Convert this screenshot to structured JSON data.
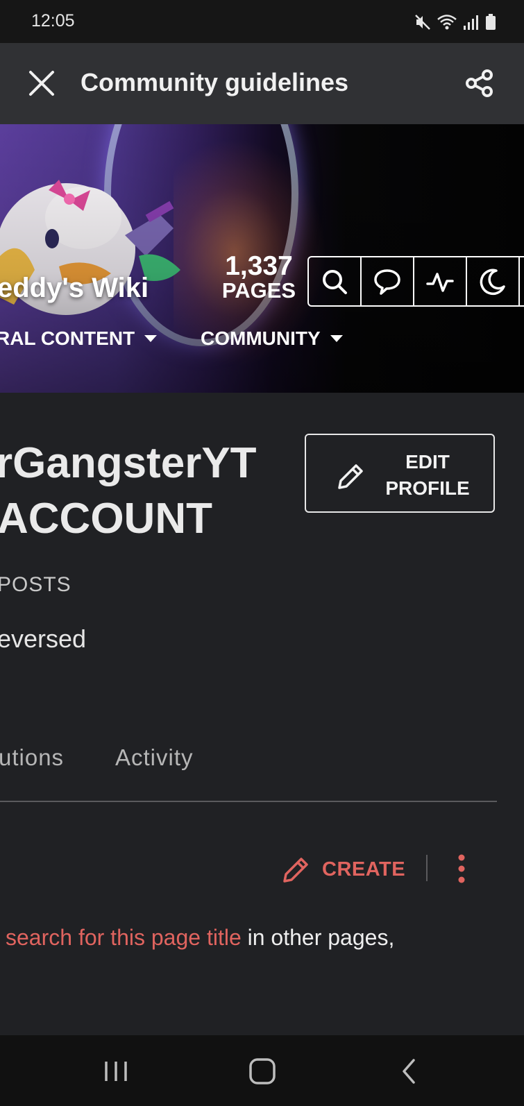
{
  "status_bar": {
    "time": "12:05",
    "icons": [
      "mute-icon",
      "wifi-icon",
      "signal-icon",
      "battery-icon"
    ]
  },
  "app_bar": {
    "title": "Community guidelines",
    "close_icon": "close-icon",
    "share_icon": "share-icon"
  },
  "hero": {
    "wiki_name": "eddy's Wiki",
    "pages_count": "1,337",
    "pages_label": "PAGES",
    "toolbar_icons": [
      "search-icon",
      "discussions-icon",
      "activity-icon",
      "theme-moon-icon"
    ],
    "nav": [
      "RAL CONTENT",
      "COMMUNITY"
    ]
  },
  "profile": {
    "name": "rGangsterYT",
    "subtitle": "ACCOUNT",
    "edit_button": {
      "line1": "EDIT",
      "line2": "PROFILE"
    },
    "posts_label": "POSTS",
    "bio": "eversed"
  },
  "tabs": [
    "utions",
    "Activity"
  ],
  "actions": {
    "create_label": "CREATE"
  },
  "body": {
    "link_text": "search for this page title",
    "rest_text": " in other pages,"
  },
  "colors": {
    "accent": "#e0645f",
    "background": "#202124",
    "app_bar": "#303134",
    "status_bar": "#161616",
    "nav_bar": "#111111"
  },
  "system_nav": [
    "recent-apps-icon",
    "home-icon",
    "back-icon"
  ]
}
